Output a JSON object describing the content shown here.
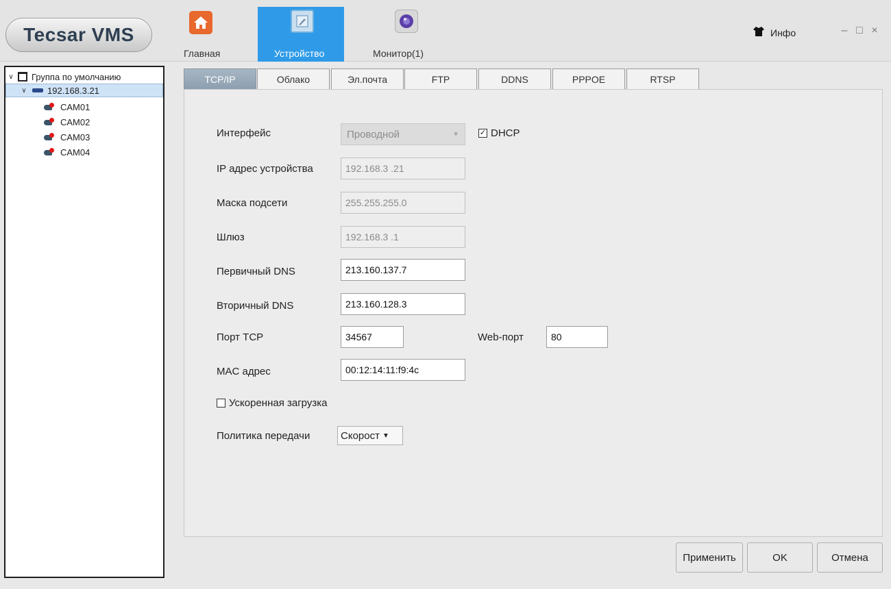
{
  "app": {
    "logo": "Tecsar VMS"
  },
  "nav": {
    "home": "Главная",
    "device": "Устройство",
    "monitor": "Монитор(1)"
  },
  "header": {
    "info": "Инфо",
    "info_icon": "shirt-icon"
  },
  "window_controls": {
    "minimize": "–",
    "maximize": "□",
    "close": "×"
  },
  "tree": {
    "group": "Группа по умолчанию",
    "device": "192.168.3.21",
    "cameras": [
      "CAM01",
      "CAM02",
      "CAM03",
      "CAM04"
    ]
  },
  "tabs": [
    "TCP/IP",
    "Облако",
    "Эл.почта",
    "FTP",
    "DDNS",
    "PPPOE",
    "RTSP"
  ],
  "active_tab": "TCP/IP",
  "form": {
    "interface_label": "Интерфейс",
    "interface_value": "Проводной",
    "dhcp_label": "DHCP",
    "dhcp_checked": true,
    "ip_label": "IP адрес устройства",
    "ip_value": "192.168.3 .21",
    "mask_label": "Маска подсети",
    "mask_value": "255.255.255.0",
    "gateway_label": "Шлюз",
    "gateway_value": "192.168.3 .1",
    "dns1_label": "Первичный DNS",
    "dns1_value": "213.160.137.7",
    "dns2_label": "Вторичный DNS",
    "dns2_value": "213.160.128.3",
    "tcp_port_label": "Порт TCP",
    "tcp_port_value": "34567",
    "web_port_label": "Web-порт",
    "web_port_value": "80",
    "mac_label": "MAC адрес",
    "mac_value": "00:12:14:11:f9:4c",
    "fast_load_label": "Ускоренная загрузка",
    "fast_load_checked": false,
    "policy_label": "Политика передачи",
    "policy_value": "Скорост"
  },
  "buttons": {
    "apply": "Применить",
    "ok": "OK",
    "cancel": "Отмена"
  },
  "colors": {
    "active_nav": "#2f9be8",
    "active_tab": "#97a8b8",
    "home_icon": "#e8682e"
  }
}
